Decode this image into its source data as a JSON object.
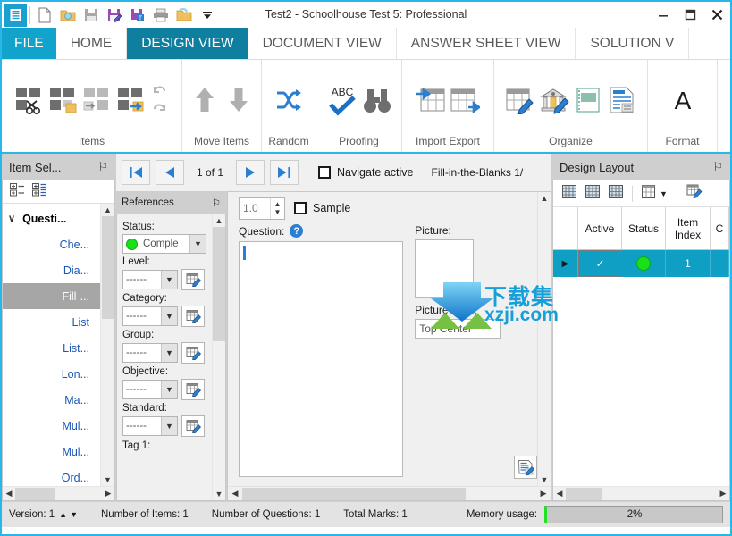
{
  "window": {
    "title": "Test2 - Schoolhouse Test 5: Professional",
    "minimize": "–",
    "maximize": "❐",
    "close": "✕"
  },
  "quick_access": {
    "items": [
      {
        "name": "app-menu-icon",
        "label": ""
      },
      {
        "name": "new-document-icon",
        "label": ""
      },
      {
        "name": "open-folder-icon",
        "label": ""
      },
      {
        "name": "save-icon",
        "label": ""
      },
      {
        "name": "save-edit-icon",
        "label": ""
      },
      {
        "name": "save-template-icon",
        "label": ""
      },
      {
        "name": "print-icon",
        "label": ""
      },
      {
        "name": "open-recent-icon",
        "label": ""
      },
      {
        "name": "customize-dropdown-icon",
        "label": "▼"
      }
    ]
  },
  "tabs": [
    {
      "label": "FILE",
      "state": "file"
    },
    {
      "label": "HOME",
      "state": "normal"
    },
    {
      "label": "DESIGN VIEW",
      "state": "active"
    },
    {
      "label": "DOCUMENT VIEW",
      "state": "normal"
    },
    {
      "label": "ANSWER SHEET VIEW",
      "state": "normal"
    },
    {
      "label": "SOLUTION V",
      "state": "normal"
    }
  ],
  "ribbon": {
    "groups": [
      {
        "label": "Items",
        "buttons": [
          "cut-items-icon",
          "copy-items-icon",
          "paste-items-icon",
          "move-items-icon",
          "undo-icon",
          "redo-icon"
        ]
      },
      {
        "label": "Move Items",
        "buttons": [
          "move-up-icon",
          "move-down-icon"
        ]
      },
      {
        "label": "Random",
        "buttons": [
          "randomize-icon"
        ]
      },
      {
        "label": "Proofing",
        "buttons": [
          "spell-check-icon",
          "find-icon"
        ]
      },
      {
        "label": "Import Export",
        "buttons": [
          "import-icon",
          "export-icon"
        ]
      },
      {
        "label": "Organize",
        "buttons": [
          "edit-table-icon",
          "bank-edit-icon",
          "notebook-icon",
          "document-list-icon"
        ]
      },
      {
        "label": "Format",
        "buttons": [
          "font-format-icon"
        ]
      }
    ]
  },
  "left_panel": {
    "title": "Item Sel...",
    "pin": "⚐",
    "toolbar": [
      "expand-all-icon",
      "collapse-all-icon"
    ],
    "tree": {
      "root": {
        "label": "Questi...",
        "caret": "∨"
      },
      "items": [
        {
          "label": "Che...",
          "selected": false
        },
        {
          "label": "Dia...",
          "selected": false
        },
        {
          "label": "Fill-...",
          "selected": true
        },
        {
          "label": "List",
          "selected": false
        },
        {
          "label": "List...",
          "selected": false
        },
        {
          "label": "Lon...",
          "selected": false
        },
        {
          "label": "Ma...",
          "selected": false
        },
        {
          "label": "Mul...",
          "selected": false
        },
        {
          "label": "Mul...",
          "selected": false
        },
        {
          "label": "Ord...",
          "selected": false
        }
      ]
    }
  },
  "navbar": {
    "first_label": "◀▐",
    "prev_label": "◀",
    "position": "1 of 1",
    "next_label": "▶",
    "last_label": "▌▶",
    "navigate_active_label": "Navigate active",
    "item_type": "Fill-in-the-Blanks  1/"
  },
  "references": {
    "title": "References",
    "pin": "⚐",
    "fields": [
      {
        "label": "Status:",
        "value": "Comple",
        "has_dot": true,
        "has_edit": false
      },
      {
        "label": "Level:",
        "value": "------",
        "has_dot": false,
        "has_edit": true
      },
      {
        "label": "Category:",
        "value": "------",
        "has_dot": false,
        "has_edit": true
      },
      {
        "label": "Group:",
        "value": "------",
        "has_dot": false,
        "has_edit": true
      },
      {
        "label": "Objective:",
        "value": "------",
        "has_dot": false,
        "has_edit": true
      },
      {
        "label": "Standard:",
        "value": "------",
        "has_dot": false,
        "has_edit": true
      },
      {
        "label": "Tag 1:",
        "value": "",
        "has_dot": false,
        "has_edit": false
      }
    ]
  },
  "form": {
    "marks_value": "1.0",
    "sample_label": "Sample",
    "question_label": "Question:",
    "question_value": "",
    "picture_label": "Picture:",
    "picture_align_label": "Picture align:",
    "picture_align_value": "Top Center"
  },
  "design_layout": {
    "title": "Design Layout",
    "pin": "⚐",
    "toolbar": [
      "grid-view-1-icon",
      "grid-view-2-icon",
      "grid-view-3-icon",
      "grid-select-icon",
      "grid-dropdown-icon",
      "grid-edit-icon"
    ],
    "columns": [
      "",
      "Active",
      "Status",
      "Item Index",
      "C"
    ],
    "rows": [
      {
        "marker": "▶",
        "active": "✓",
        "status": "green",
        "item_index": "1",
        "extra": ""
      }
    ]
  },
  "status_bar": {
    "version_label": "Version: 1",
    "version_up": "▲",
    "version_down": "▼",
    "items_count": "Number of Items: 1",
    "questions_count": "Number of Questions: 1",
    "total_marks": "Total Marks: 1",
    "memory_label": "Memory usage:",
    "memory_value": "2%"
  },
  "watermark": {
    "text": "下载集",
    "subtext": "xzji.com"
  },
  "colors": {
    "accent_cyan": "#29b6e8",
    "tab_file": "#12a3cc",
    "tab_active": "#0f7fa0",
    "grid_row_selected": "#0f9fc4",
    "status_green": "#19e019",
    "link_blue": "#1a57b5"
  }
}
